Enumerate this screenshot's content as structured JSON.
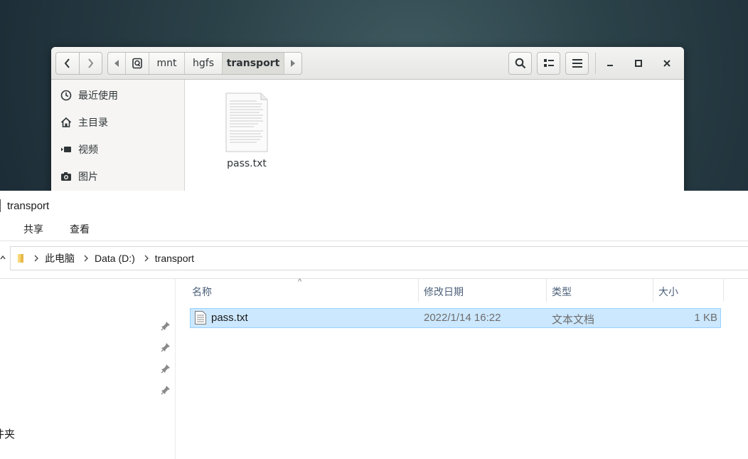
{
  "gnome": {
    "nav": {
      "back_icon": "chevron-left-icon",
      "forward_icon": "chevron-right-icon"
    },
    "path": {
      "segments": [
        "mnt",
        "hgfs",
        "transport"
      ],
      "active": "transport"
    },
    "toolbar": {
      "search_icon": "search-icon",
      "view_icon": "list-view-icon",
      "menu_icon": "hamburger-menu-icon"
    },
    "window_controls": [
      "minimize-icon",
      "maximize-icon",
      "close-icon"
    ],
    "sidebar": {
      "items": [
        {
          "label": "最近使用",
          "icon": "clock-icon"
        },
        {
          "label": "主目录",
          "icon": "home-icon"
        },
        {
          "label": "视频",
          "icon": "video-icon"
        },
        {
          "label": "图片",
          "icon": "camera-icon"
        }
      ]
    },
    "content": {
      "files": [
        {
          "name": "pass.txt",
          "icon": "text-file-icon"
        }
      ]
    }
  },
  "explorer": {
    "title": "transport",
    "ribbon": {
      "tabs": [
        "共享",
        "查看"
      ]
    },
    "address": {
      "crumbs": [
        "此电脑",
        "Data (D:)",
        "transport"
      ]
    },
    "nav_partial_label": "件夹",
    "columns": {
      "name": "名称",
      "modified": "修改日期",
      "type": "类型",
      "size": "大小"
    },
    "rows": [
      {
        "name": "pass.txt",
        "modified": "2022/1/14 16:22",
        "type": "文本文档",
        "size": "1 KB",
        "selected": true
      }
    ]
  },
  "colors": {
    "desktop": "#1f3540",
    "selection_bg": "#cce8ff",
    "selection_border": "#99d1ff",
    "header_text": "#4c607a"
  }
}
